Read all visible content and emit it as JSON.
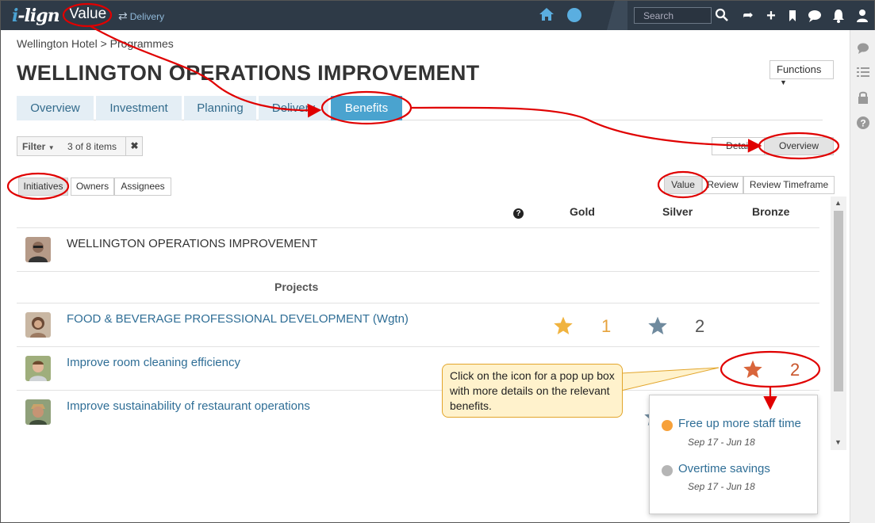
{
  "topbar": {
    "logo": "i-lign",
    "app_title": "Value",
    "switch_label": "Delivery",
    "search_placeholder": "Search"
  },
  "breadcrumb": "Wellington Hotel > Programmes",
  "page_title": "WELLINGTON OPERATIONS IMPROVEMENT",
  "functions_label": "Functions",
  "tabs": [
    "Overview",
    "Investment",
    "Planning",
    "Delivery",
    "Benefits"
  ],
  "active_tab": "Benefits",
  "filter": {
    "label": "Filter",
    "count": "3 of 8 items"
  },
  "view_toggle": [
    "Detail",
    "Overview"
  ],
  "group_toggle": [
    "Initiatives",
    "Owners",
    "Assignees"
  ],
  "mode_toggle": [
    "Value",
    "Review",
    "Review Timeframe"
  ],
  "columns": [
    "Gold",
    "Silver",
    "Bronze"
  ],
  "programme_row": "WELLINGTON OPERATIONS IMPROVEMENT",
  "projects_heading": "Projects",
  "projects": [
    {
      "name": "FOOD & BEVERAGE PROFESSIONAL DEVELOPMENT (Wgtn)",
      "gold": "1",
      "silver": "2",
      "bronze": ""
    },
    {
      "name": "Improve room cleaning efficiency",
      "gold": "",
      "silver": "",
      "bronze": "2"
    },
    {
      "name": "Improve sustainability of restaurant operations",
      "gold": "",
      "silver": "",
      "bronze": ""
    }
  ],
  "callout": "Click on the icon for a pop up box with more details on the relevant benefits.",
  "popup": [
    {
      "title": "Free up more staff time",
      "dates": "Sep 17 - Jun 18",
      "color": "#f7a13a"
    },
    {
      "title": "Overtime savings",
      "dates": "Sep 17 - Jun 18",
      "color": "#b5b5b5"
    }
  ],
  "colors": {
    "gold": "#f0b33f",
    "silver": "#6f8a9e",
    "bronze": "#d9653b",
    "topbar": "#2e3a47",
    "tab_active": "#4aa3cf",
    "annotation": "#e00000"
  }
}
